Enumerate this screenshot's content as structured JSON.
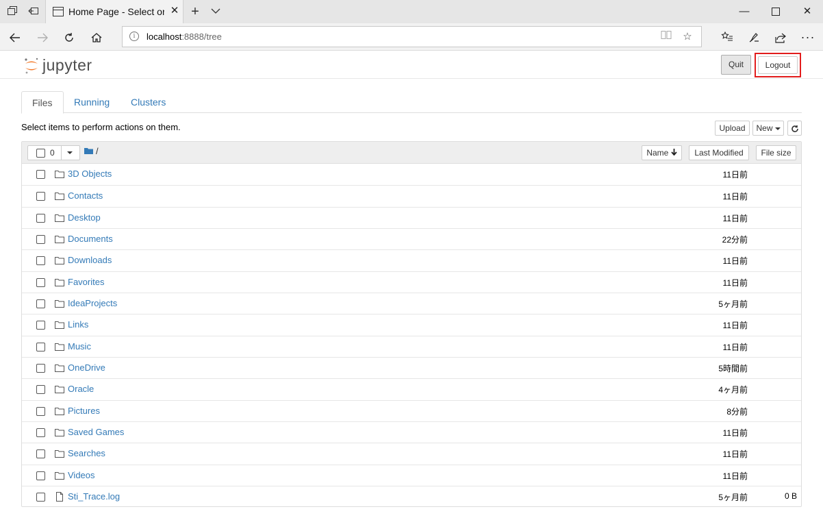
{
  "browser": {
    "tab_title": "Home Page - Select or c",
    "url_host": "localhost",
    "url_rest": ":8888/tree"
  },
  "header": {
    "logo_text": "jupyter",
    "quit_label": "Quit",
    "logout_label": "Logout"
  },
  "tabs": [
    {
      "label": "Files",
      "active": true
    },
    {
      "label": "Running",
      "active": false
    },
    {
      "label": "Clusters",
      "active": false
    }
  ],
  "toolbar": {
    "hint": "Select items to perform actions on them.",
    "upload_label": "Upload",
    "new_label": "New"
  },
  "list_header": {
    "selected_count": "0",
    "breadcrumb": "/",
    "name_label": "Name",
    "last_modified_label": "Last Modified",
    "file_size_label": "File size"
  },
  "items": [
    {
      "name": "3D Objects",
      "type": "folder",
      "modified": "11日前",
      "size": ""
    },
    {
      "name": "Contacts",
      "type": "folder",
      "modified": "11日前",
      "size": ""
    },
    {
      "name": "Desktop",
      "type": "folder",
      "modified": "11日前",
      "size": ""
    },
    {
      "name": "Documents",
      "type": "folder",
      "modified": "22分前",
      "size": ""
    },
    {
      "name": "Downloads",
      "type": "folder",
      "modified": "11日前",
      "size": ""
    },
    {
      "name": "Favorites",
      "type": "folder",
      "modified": "11日前",
      "size": ""
    },
    {
      "name": "IdeaProjects",
      "type": "folder",
      "modified": "5ヶ月前",
      "size": ""
    },
    {
      "name": "Links",
      "type": "folder",
      "modified": "11日前",
      "size": ""
    },
    {
      "name": "Music",
      "type": "folder",
      "modified": "11日前",
      "size": ""
    },
    {
      "name": "OneDrive",
      "type": "folder",
      "modified": "5時間前",
      "size": ""
    },
    {
      "name": "Oracle",
      "type": "folder",
      "modified": "4ヶ月前",
      "size": ""
    },
    {
      "name": "Pictures",
      "type": "folder",
      "modified": "8分前",
      "size": ""
    },
    {
      "name": "Saved Games",
      "type": "folder",
      "modified": "11日前",
      "size": ""
    },
    {
      "name": "Searches",
      "type": "folder",
      "modified": "11日前",
      "size": ""
    },
    {
      "name": "Videos",
      "type": "folder",
      "modified": "11日前",
      "size": ""
    },
    {
      "name": "Sti_Trace.log",
      "type": "file",
      "modified": "5ヶ月前",
      "size": "0 B"
    }
  ],
  "colors": {
    "link": "#337ab7",
    "highlight": "#e21c1c",
    "jupyter_orange": "#f37726"
  }
}
